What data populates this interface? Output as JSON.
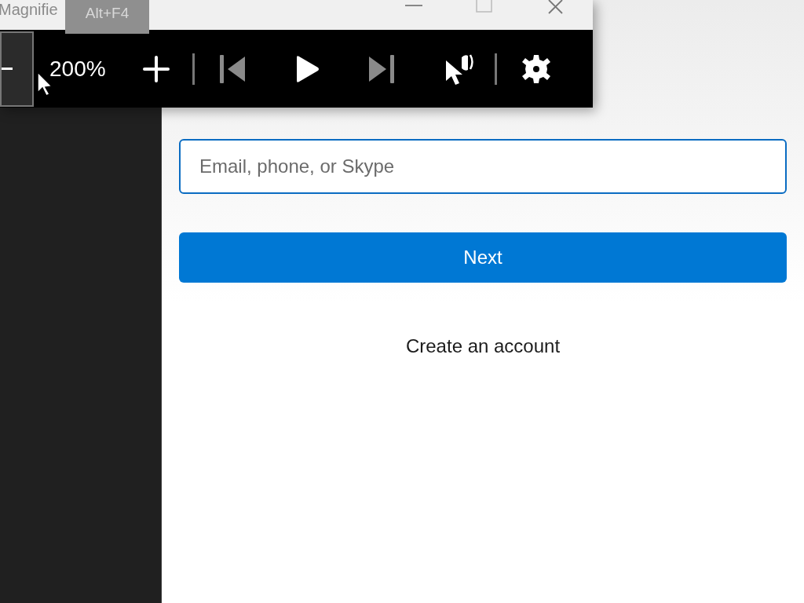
{
  "magnifier": {
    "title": "Magnifie",
    "tooltip": "Alt+F4",
    "zoom_level": "200%",
    "media": [
      {
        "kind": "previous",
        "disabled": true
      },
      {
        "kind": "play",
        "disabled": false
      },
      {
        "kind": "next",
        "disabled": true
      }
    ]
  },
  "signin": {
    "placeholder": "Email, phone, or Skype",
    "next_button": "Next",
    "create_link": "Create an account"
  }
}
